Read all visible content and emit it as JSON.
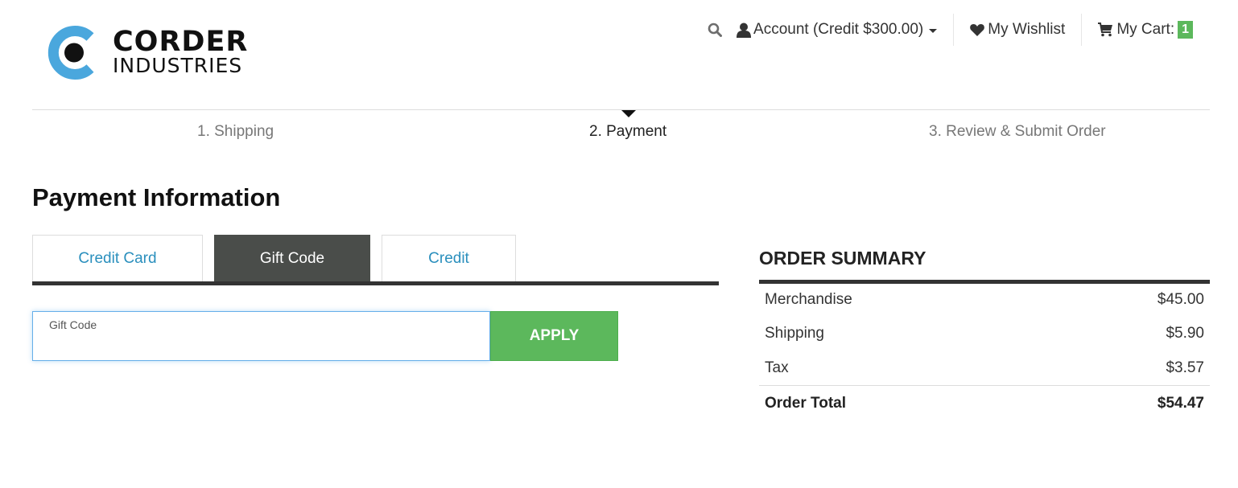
{
  "brand": {
    "line1": "CORDER",
    "line2": "INDUSTRIES",
    "accent_color": "#4aa7dd"
  },
  "topnav": {
    "search_icon": "search-icon",
    "account_label": "Account (Credit $300.00)",
    "wishlist_label": "My Wishlist",
    "cart_label": "My Cart:",
    "cart_count": "1"
  },
  "steps": [
    {
      "label": "1. Shipping",
      "active": false
    },
    {
      "label": "2. Payment",
      "active": true
    },
    {
      "label": "3. Review & Submit Order",
      "active": false
    }
  ],
  "page_title": "Payment Information",
  "payment_tabs": [
    {
      "label": "Credit Card",
      "active": false
    },
    {
      "label": "Gift Code",
      "active": true
    },
    {
      "label": "Credit",
      "active": false
    }
  ],
  "gift_form": {
    "label": "Gift Code",
    "value": "",
    "apply_label": "APPLY"
  },
  "order_summary": {
    "title": "ORDER SUMMARY",
    "rows": [
      {
        "label": "Merchandise",
        "value": "$45.00"
      },
      {
        "label": "Shipping",
        "value": "$5.90"
      },
      {
        "label": "Tax",
        "value": "$3.57"
      }
    ],
    "total_label": "Order Total",
    "total_value": "$54.47"
  },
  "colors": {
    "link_blue": "#2a8fbd",
    "active_tab": "#4a4d4a",
    "apply_green": "#5cb85c"
  }
}
